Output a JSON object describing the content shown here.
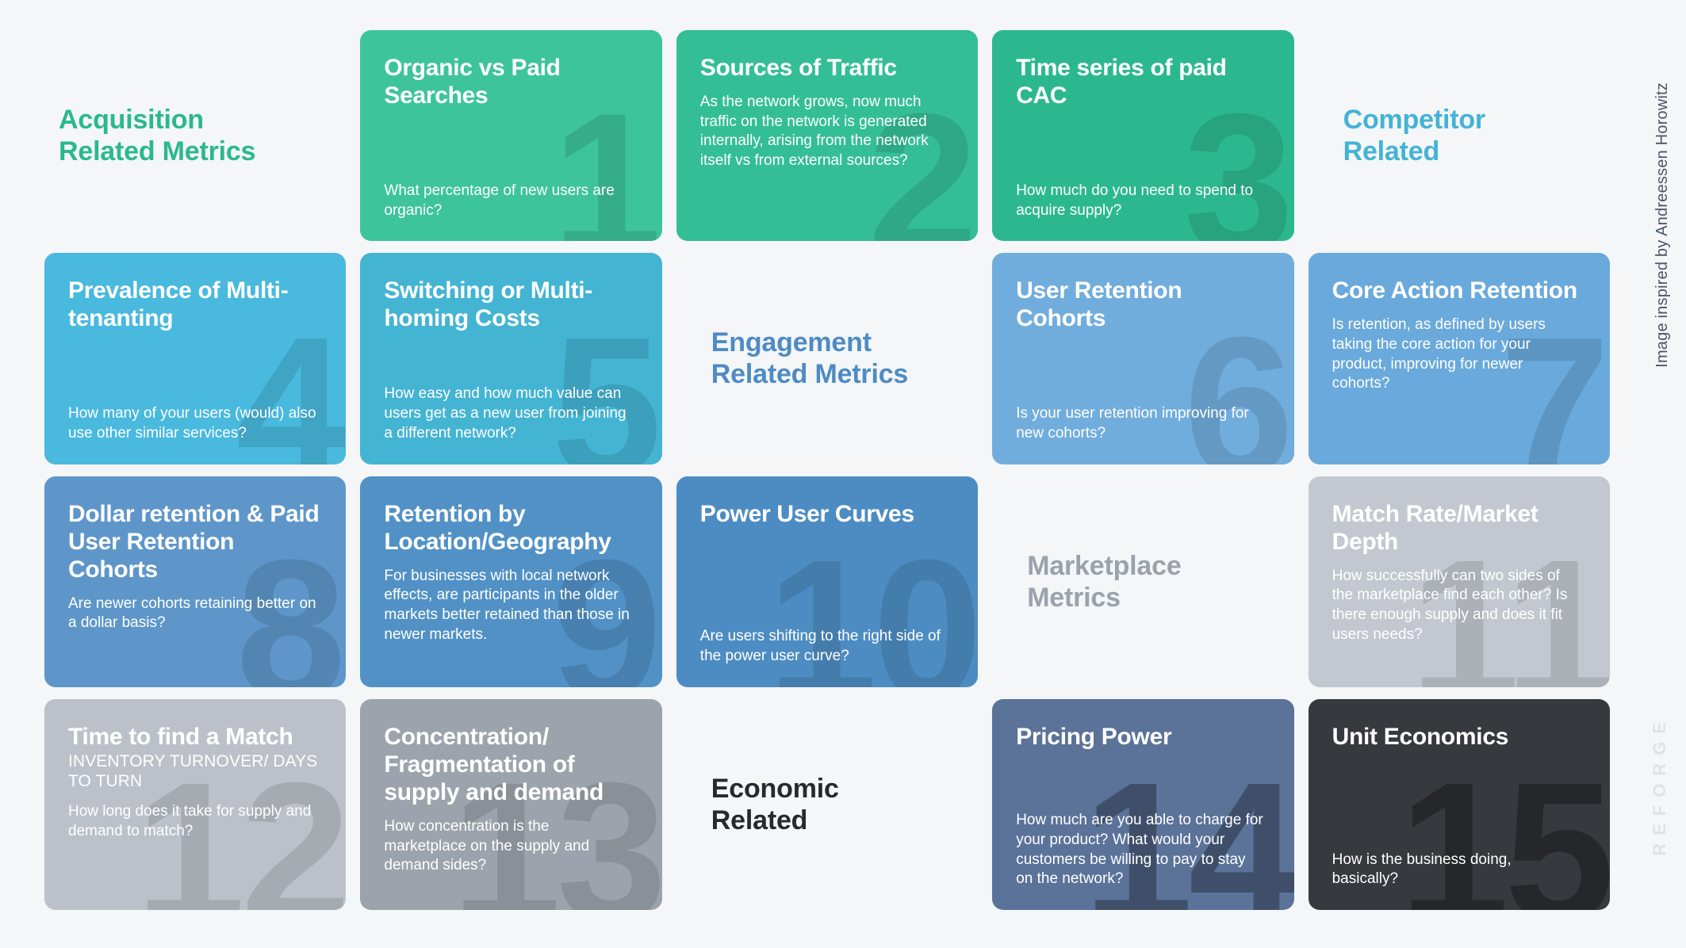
{
  "background": "#f4f6f7",
  "rail": {
    "credit": "Image inspired by Andreessen Horowitz",
    "brand": "REFORGE"
  },
  "sections": {
    "acquisition": {
      "label": "Acquisition\nRelated Metrics",
      "color": "#2BB98A"
    },
    "competitor": {
      "label": "Competitor\nRelated",
      "color": "#43B3D6"
    },
    "engagement": {
      "label": "Engagement\nRelated Metrics",
      "color": "#4E8BC4"
    },
    "marketplace": {
      "label": "Marketplace\nMetrics",
      "color": "#9AA2AC"
    },
    "economic": {
      "label": "Economic\nRelated",
      "color": "#262A2E"
    }
  },
  "cards": [
    {
      "number": "1",
      "title": "Organic vs Paid Searches",
      "subtitle": "",
      "body": "What percentage of new users are organic?",
      "color": "#3DC49B"
    },
    {
      "number": "2",
      "title": "Sources of Traffic",
      "subtitle": "",
      "body": "As the network grows, now much traffic on the network is generated internally, arising from the network itself vs from external sources?",
      "color": "#34BE96"
    },
    {
      "number": "3",
      "title": "Time series of paid CAC",
      "subtitle": "",
      "body": "How much do you need to spend to acquire supply?",
      "color": "#2CB88E"
    },
    {
      "number": "4",
      "title": "Prevalence of Multi-tenanting",
      "subtitle": "",
      "body": "How many of your users (would) also use other similar services?",
      "color": "#49B9DE"
    },
    {
      "number": "5",
      "title": "Switching or Multi-homing Costs",
      "subtitle": "",
      "body": "How easy and how much value can users get as a new user from joining a different network?",
      "color": "#44B4D3"
    },
    {
      "number": "6",
      "title": "User Retention Cohorts",
      "subtitle": "",
      "body": "Is your user retention improving for new cohorts?",
      "color": "#71ADDC"
    },
    {
      "number": "7",
      "title": "Core Action Retention",
      "subtitle": "",
      "body": "Is retention, as defined by users taking the core action for your product, improving for newer cohorts?",
      "color": "#6AA9DB"
    },
    {
      "number": "8",
      "title": "Dollar retention & Paid User Retention Cohorts",
      "subtitle": "",
      "body": "Are newer cohorts retaining better on a dollar basis?",
      "color": "#5E96C9"
    },
    {
      "number": "9",
      "title": "Retention by Location/Geography",
      "subtitle": "",
      "body": "For businesses with local network effects, are participants in the older markets better retained than those in newer markets.",
      "color": "#5191C6"
    },
    {
      "number": "10",
      "title": "Power User Curves",
      "subtitle": "",
      "body": "Are users shifting to the right side of the power user curve?",
      "color": "#4D8CC2"
    },
    {
      "number": "11",
      "title": "Match Rate/Market Depth",
      "subtitle": "",
      "body": "How successfully can two sides of the marketplace find each other? Is there enough supply and does it fit users needs?",
      "color": "#C3C8D0"
    },
    {
      "number": "12",
      "title": "Time to find a Match",
      "subtitle": "INVENTORY TURNOVER/ DAYS TO TURN",
      "body": "How long does it take for supply and demand to match?",
      "color": "#BCC1C9"
    },
    {
      "number": "13",
      "title": "Concentration/ Fragmentation of supply and demand",
      "subtitle": "",
      "body": "How concentration is the marketplace on the supply and demand sides?",
      "color": "#9CA3AC"
    },
    {
      "number": "14",
      "title": "Pricing Power",
      "subtitle": "",
      "body": "How much are you able to charge for your product? What would your customers be willing to pay to stay on the network?",
      "color": "#5B7299"
    },
    {
      "number": "15",
      "title": "Unit Economics",
      "subtitle": "",
      "body": "How is the business doing, basically?",
      "color": "#36393D"
    }
  ]
}
